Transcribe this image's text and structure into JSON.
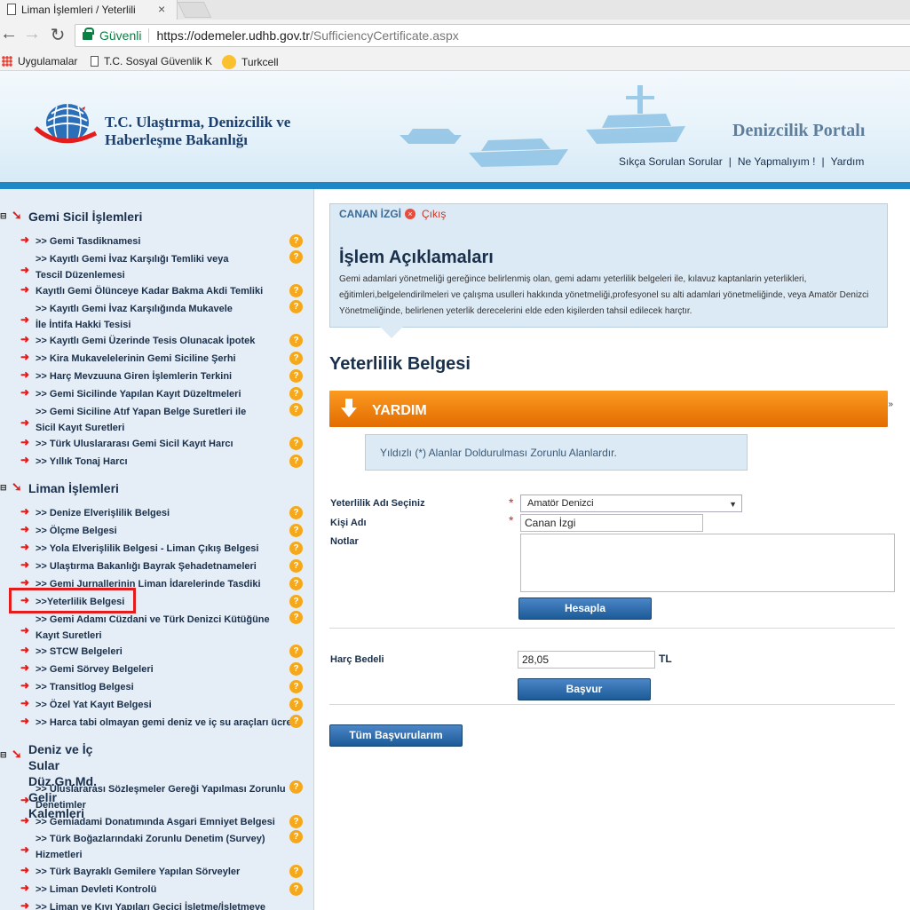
{
  "browser": {
    "tab_title": "Liman İşlemleri / Yeterlili",
    "tab_close": "×",
    "secure_label": "Güvenli",
    "url_host": "https://odemeler.udhb.gov.tr",
    "url_path": "/SufficiencyCertificate.aspx",
    "bookmarks": [
      "Uygulamalar",
      "T.C. Sosyal Güvenlik K",
      "Turkcell"
    ]
  },
  "header": {
    "ministry_name": "T.C. Ulaştırma, Denizcilik ve\nHaberleşme Bakanlığı",
    "portal_title": "Denizcilik Portalı",
    "links": [
      "Sıkça Sorulan Sorular",
      "Ne Yapmalıyım !",
      "Yardım"
    ],
    "link_divider": "|"
  },
  "sidebar": {
    "help_icon": "?",
    "sections": [
      {
        "title": "Gemi Sicil İşlemleri",
        "items": [
          ">> Gemi Tasdiknamesi",
          ">> Kayıtlı Gemi İvaz Karşılığı Temliki veya\nTescil Düzenlemesi",
          "Kayıtlı Gemi Ölünceye Kadar Bakma Akdi Temliki",
          ">> Kayıtlı Gemi İvaz Karşılığında Mukavele\nİle İntifa Hakki Tesisi",
          ">> Kayıtlı Gemi Üzerinde Tesis Olunacak İpotek",
          ">> Kira Mukavelelerinin Gemi Siciline Şerhi",
          ">> Harç Mevzuuna Giren İşlemlerin Terkini",
          ">> Gemi Sicilinde Yapılan Kayıt Düzeltmeleri",
          ">> Gemi Siciline Atıf Yapan Belge Suretleri ile\nSicil Kayıt Suretleri",
          ">> Türk Uluslararası Gemi Sicil Kayıt Harcı",
          ">> Yıllık Tonaj Harcı"
        ]
      },
      {
        "title": "Liman İşlemleri",
        "items": [
          ">> Denize Elverişlilik Belgesi",
          ">> Ölçme Belgesi",
          ">> Yola Elverişlilik Belgesi - Liman Çıkış Belgesi",
          ">> Ulaştırma Bakanlığı Bayrak Şehadetnameleri",
          ">> Gemi Jurnallerinin Liman İdarelerinde Tasdiki",
          ">>Yeterlilik Belgesi",
          ">> Gemi Adamı Cüzdani ve Türk Denizci Kütüğüne\nKayıt Suretleri",
          ">> STCW Belgeleri",
          ">> Gemi Sörvey Belgeleri",
          ">> Transitlog Belgesi",
          ">> Özel Yat Kayıt Belgesi",
          ">> Harca tabi olmayan gemi deniz ve iç su araçları ücreti"
        ]
      },
      {
        "title": "Deniz ve İç Sular Düz.Gn.Md.\nGelir Kalemleri",
        "items": [
          ">> Uluslararası Sözleşmeler Gereği Yapılması Zorunlu\nDenetimler",
          ">> Gemiadami Donatımında Asgari Emniyet Belgesi",
          ">> Türk Boğazlarındaki Zorunlu Denetim (Survey)\nHizmetleri",
          ">> Türk Bayraklı Gemilere Yapılan Sörveyler",
          ">> Liman Devleti Kontrolü",
          ">> Liman ve Kıyı Yapıları Geçici İşletme/İşletmeye"
        ]
      }
    ]
  },
  "main": {
    "user_name": "CANAN İZGİ",
    "logout_icon": "×",
    "logout_label": "Çıkış",
    "description_title": "İşlem Açıklamaları",
    "description_text": "Gemi adamlari yönetmeliği gereğince belirlenmiş olan, gemi adamı yeterlilik belgeleri ile, kılavuz kaptanlarin yeterlikleri, eğitimleri,belgelendirilmeleri ve çalışma usulleri hakkında yönetmeliği,profesyonel su alti adamlari yönetmeliğinde, veya Amatör Denizci Yönetmeliğinde, belirlenen yeterlik derecelerini elde eden kişilerden tahsil edilecek harçtır.",
    "page_heading": "Yeterlilik Belgesi",
    "help_bar_label": "YARDIM",
    "help_bar_chevron": "»",
    "info_text": "Yıldızlı (*) Alanlar Doldurulması Zorunlu Alanlardır.",
    "required_mark": "*",
    "form": {
      "qualification_label": "Yeterlilik Adı Seçiniz",
      "qualification_value": "Amatör Denizci",
      "select_caret": "▼",
      "name_label": "Kişi Adı",
      "name_value": "Canan İzgi",
      "notes_label": "Notlar",
      "calculate_button": "Hesapla",
      "fee_label": "Harç Bedeli",
      "fee_value": "28,05",
      "currency": "TL",
      "apply_button": "Başvur",
      "all_applications_button": "Tüm Başvurularım"
    }
  },
  "colors": {
    "accent": "#1e88c7",
    "orange": "#f28a14",
    "red": "#e31d1d",
    "navy": "#1a2f4a"
  }
}
